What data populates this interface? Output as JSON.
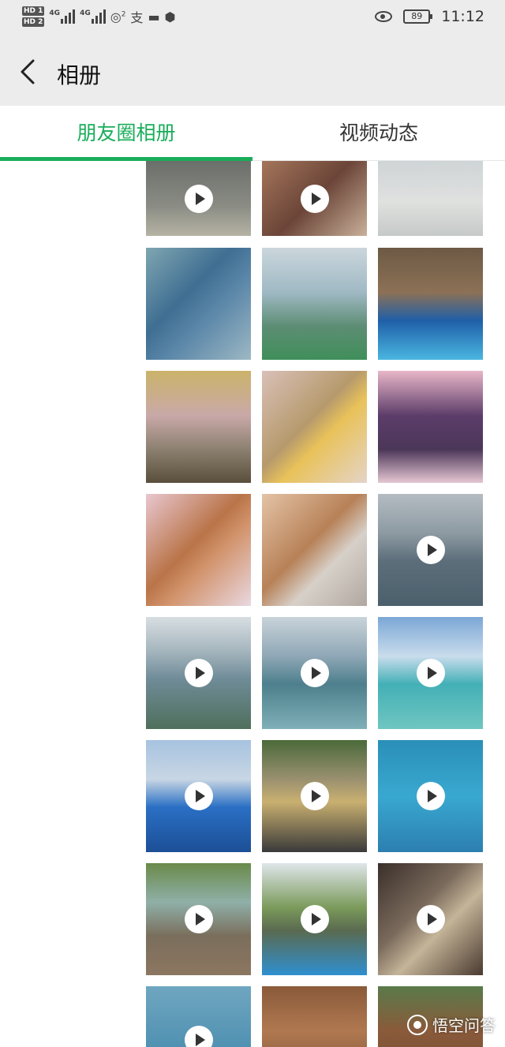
{
  "status_bar": {
    "hd1": "HD 1",
    "hd2": "HD 2",
    "network1": "4G",
    "network2": "4G",
    "hotspot_count": "2",
    "battery": "89",
    "time": "11:12",
    "icons": [
      "hd-icon",
      "signal-icon",
      "hotspot-icon",
      "alipay-icon",
      "briefcase-icon",
      "shield-app-icon",
      "eye-icon",
      "battery-icon"
    ]
  },
  "header": {
    "title": "相册",
    "back_icon": "chevron-left-icon"
  },
  "tabs": [
    {
      "label": "朋友圈相册",
      "active": true
    },
    {
      "label": "视频动态",
      "active": false
    }
  ],
  "colors": {
    "accent": "#1aad5a",
    "bar_bg": "#ececec"
  },
  "watermark": {
    "text": "悟空问答"
  }
}
